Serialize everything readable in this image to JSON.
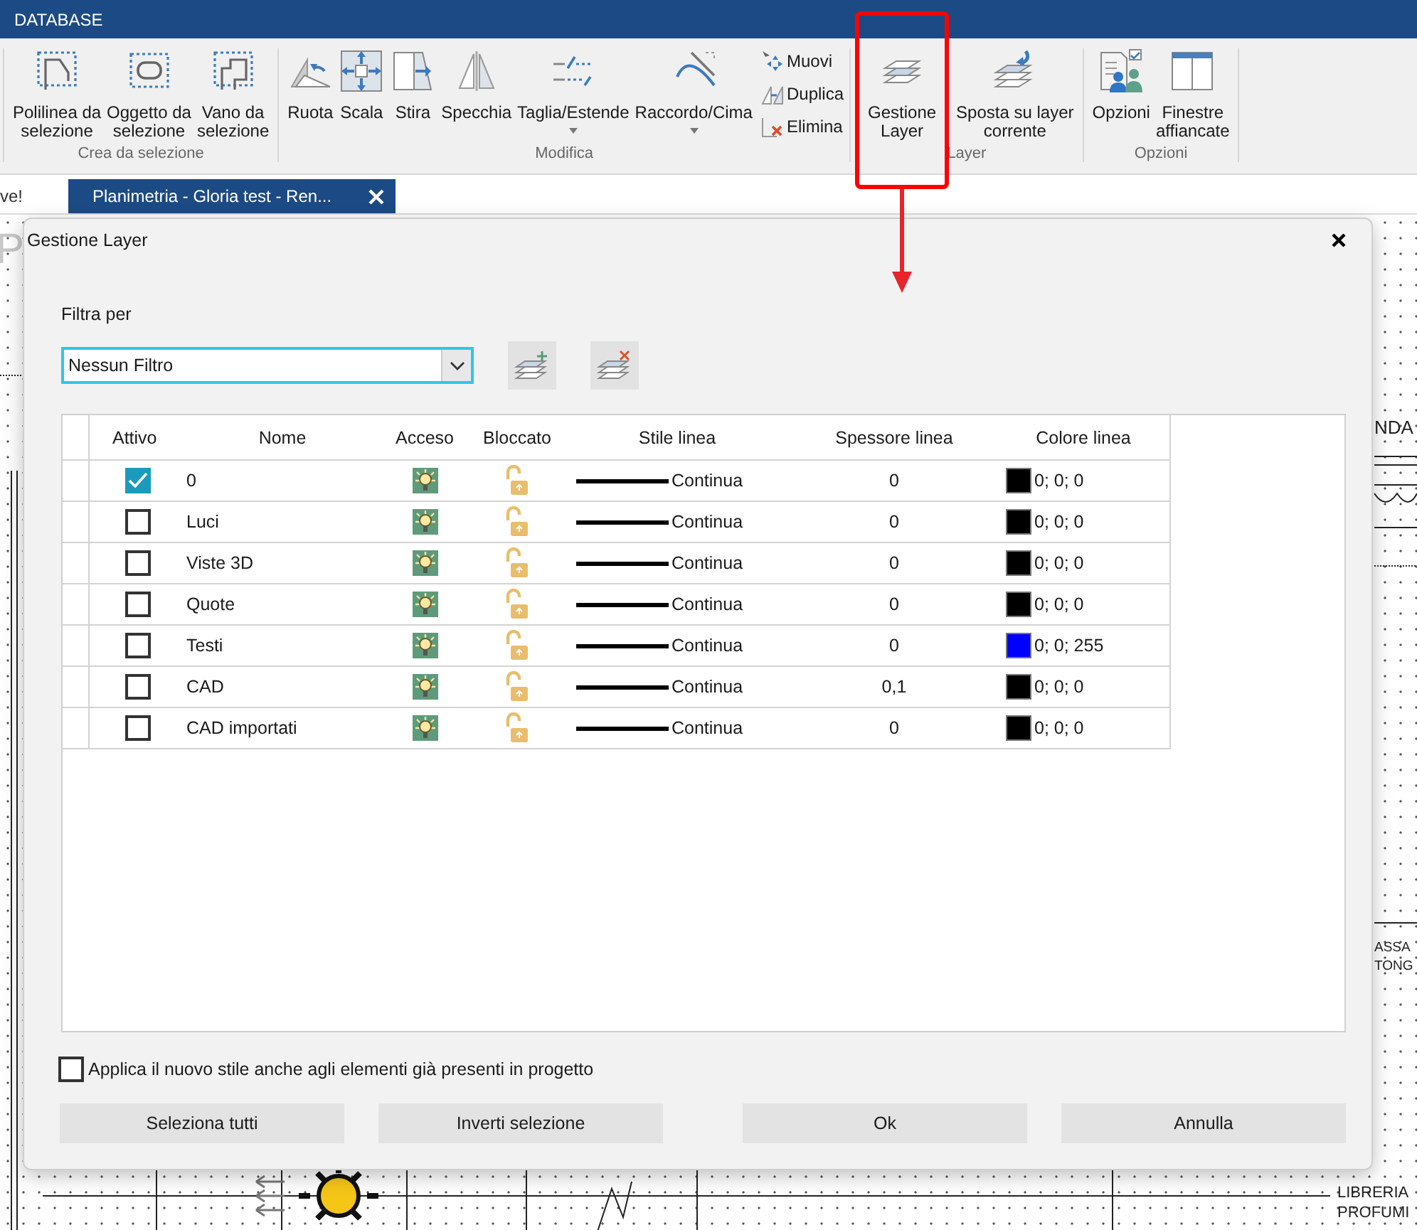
{
  "app_bar": {
    "title": "DATABASE"
  },
  "ribbon": {
    "groups": [
      {
        "label": "Crea da selezione",
        "buttons": [
          {
            "label": "Polilinea da\nselezione",
            "kind": "large",
            "menu": false
          },
          {
            "label": "Oggetto da\nselezione",
            "kind": "large",
            "menu": false
          },
          {
            "label": "Vano da\nselezione",
            "kind": "large",
            "menu": false
          }
        ]
      },
      {
        "label": "Modifica",
        "buttons": [
          {
            "label": "Ruota",
            "kind": "large",
            "menu": false
          },
          {
            "label": "Scala",
            "kind": "large",
            "menu": false
          },
          {
            "label": "Stira",
            "kind": "large",
            "menu": false
          },
          {
            "label": "Specchia",
            "kind": "large",
            "menu": false
          },
          {
            "label": "Taglia/Estende",
            "kind": "large",
            "menu": true
          },
          {
            "label": "Raccordo/Cima",
            "kind": "large",
            "menu": true
          },
          {
            "label": "Muovi",
            "kind": "small",
            "menu": false
          },
          {
            "label": "Duplica",
            "kind": "small",
            "menu": false
          },
          {
            "label": "Elimina",
            "kind": "small",
            "menu": false
          }
        ]
      },
      {
        "label": "Layer",
        "buttons": [
          {
            "label": "Gestione\nLayer",
            "kind": "large",
            "menu": false
          },
          {
            "label": "Sposta su layer\ncorrente",
            "kind": "large",
            "menu": false
          }
        ]
      },
      {
        "label": "Opzioni",
        "buttons": [
          {
            "label": "Opzioni",
            "kind": "large",
            "menu": false
          },
          {
            "label": "Finestre\naffiancate",
            "kind": "large",
            "menu": false
          }
        ]
      }
    ]
  },
  "document_tabs": [
    {
      "label": "ve!",
      "selected": false
    },
    {
      "label": "Planimetria - Gloria test - Ren...",
      "selected": true
    }
  ],
  "canvas": {
    "labels": [
      "P",
      "NDA",
      "ASSA",
      "TONG",
      "LIBRERIA",
      "PROFUMI"
    ]
  },
  "dialog": {
    "title": "Gestione Layer",
    "filter": {
      "label": "Filtra per",
      "value": "Nessun Filtro"
    },
    "table": {
      "columns": [
        "Attivo",
        "Nome",
        "Acceso",
        "Bloccato",
        "Stile linea",
        "Spessore linea",
        "Colore linea"
      ],
      "rows": [
        {
          "active": true,
          "name": "0",
          "on": true,
          "locked": false,
          "line_style": "Continua",
          "line_weight": "0",
          "color": "#000000",
          "color_text": "0; 0; 0"
        },
        {
          "active": false,
          "name": "Luci",
          "on": true,
          "locked": false,
          "line_style": "Continua",
          "line_weight": "0",
          "color": "#000000",
          "color_text": "0; 0; 0"
        },
        {
          "active": false,
          "name": "Viste 3D",
          "on": true,
          "locked": false,
          "line_style": "Continua",
          "line_weight": "0",
          "color": "#000000",
          "color_text": "0; 0; 0"
        },
        {
          "active": false,
          "name": "Quote",
          "on": true,
          "locked": false,
          "line_style": "Continua",
          "line_weight": "0",
          "color": "#000000",
          "color_text": "0; 0; 0"
        },
        {
          "active": false,
          "name": "Testi",
          "on": true,
          "locked": false,
          "line_style": "Continua",
          "line_weight": "0",
          "color": "#0000ff",
          "color_text": "0; 0; 255"
        },
        {
          "active": false,
          "name": "CAD",
          "on": true,
          "locked": false,
          "line_style": "Continua",
          "line_weight": "0,1",
          "color": "#000000",
          "color_text": "0; 0; 0"
        },
        {
          "active": false,
          "name": "CAD importati",
          "on": true,
          "locked": false,
          "line_style": "Continua",
          "line_weight": "0",
          "color": "#000000",
          "color_text": "0; 0; 0"
        }
      ]
    },
    "apply_option": {
      "label": "Applica il nuovo stile anche agli elementi già presenti in progetto",
      "checked": false
    },
    "buttons": [
      "Seleziona tutti",
      "Inverti selezione",
      "Ok",
      "Annulla"
    ]
  }
}
